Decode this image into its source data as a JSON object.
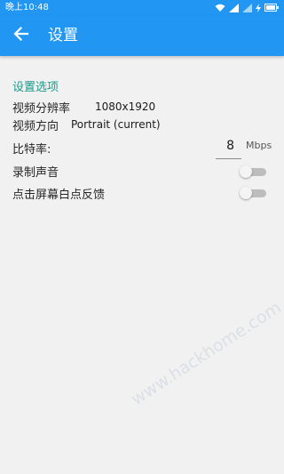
{
  "status_bar": {
    "time": "晚上10:48",
    "icons": [
      "wifi-icon",
      "signal-icon",
      "signal-icon",
      "charging-icon",
      "battery-icon"
    ]
  },
  "app_bar": {
    "back_icon": "arrow-left-icon",
    "title": "设置"
  },
  "settings": {
    "section_title": "设置选项",
    "resolution": {
      "label": "视频分辨率",
      "value": "1080x1920"
    },
    "orientation": {
      "label": "视频方向",
      "value": "Portrait (current)"
    },
    "bitrate": {
      "label": "比特率:",
      "value": "8",
      "unit": "Mbps"
    },
    "record_audio": {
      "label": "录制声音",
      "enabled": false
    },
    "show_touches": {
      "label": "点击屏幕白点反馈",
      "enabled": false
    }
  },
  "colors": {
    "primary": "#2196f3",
    "accent_text": "#1a9a8c",
    "background": "#f1f1f1"
  },
  "watermark": "www.hackhome.com"
}
